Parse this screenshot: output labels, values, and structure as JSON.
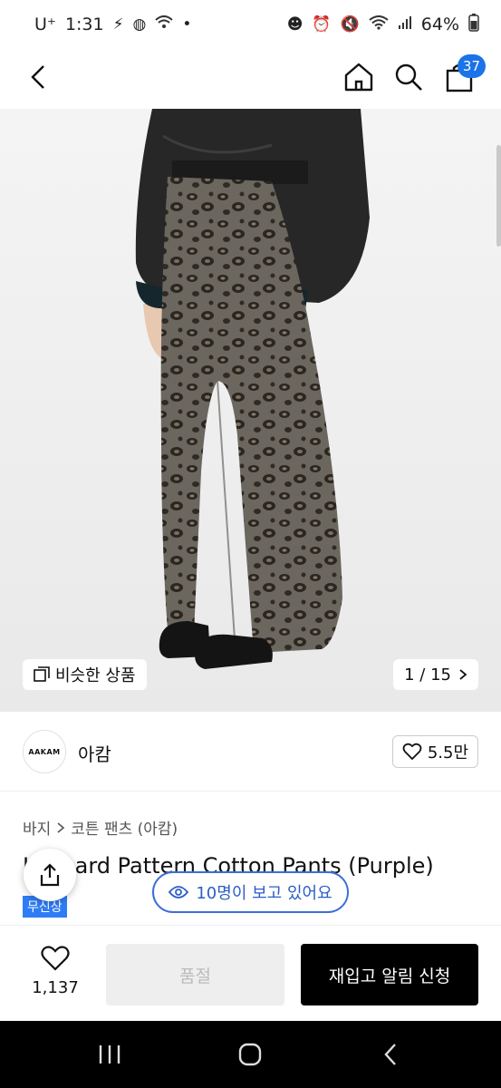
{
  "status_bar": {
    "carrier": "U⁺",
    "time": "1:31",
    "battery": "64%"
  },
  "nav": {
    "cart_count": "37"
  },
  "gallery": {
    "similar_label": "비슷한 상품",
    "page_indicator": "1 / 15"
  },
  "brand": {
    "logo_text": "AAKAM",
    "name": "아캄",
    "likes": "5.5만"
  },
  "breadcrumb": {
    "category": "바지",
    "sub": "코튼 팬츠 (아캄)"
  },
  "product": {
    "title": "Leopard Pattern Cotton Pants (Purple)",
    "badge": "무신상"
  },
  "viewers": {
    "text": "10명이 보고 있어요"
  },
  "bottom": {
    "wish_count": "1,137",
    "soldout_label": "품절",
    "restock_label": "재입고 알림 신청"
  }
}
